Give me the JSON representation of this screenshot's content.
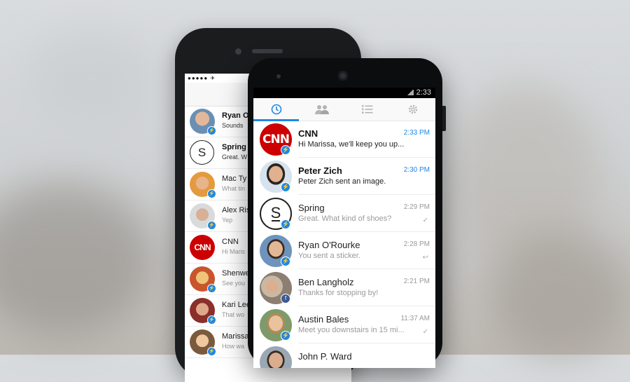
{
  "colors": {
    "accent": "#1e88e5",
    "messenger_badge": "#1e88e5",
    "facebook_badge": "#3b5998",
    "cnn_red": "#cc0000"
  },
  "iphone": {
    "status": "●●●●● ✈",
    "rows": [
      {
        "name": "Ryan O",
        "preview": "Sounds",
        "bold": true,
        "badge": "messenger-icon"
      },
      {
        "name": "Spring",
        "preview": "Great. W",
        "bold": true,
        "badge": "none"
      },
      {
        "name": "Mac Ty",
        "preview": "What tin",
        "bold": false,
        "badge": "messenger-icon"
      },
      {
        "name": "Alex Ris",
        "preview": "Yep",
        "bold": false,
        "badge": "messenger-icon"
      },
      {
        "name": "CNN",
        "preview": "Hi Maris",
        "bold": false,
        "badge": "none"
      },
      {
        "name": "Shenwe",
        "preview": "See you",
        "bold": false,
        "badge": "messenger-icon"
      },
      {
        "name": "Kari Lee",
        "preview": "That wo",
        "bold": false,
        "badge": "messenger-icon"
      },
      {
        "name": "Marissa",
        "preview": "How wa",
        "bold": false,
        "badge": "messenger-icon"
      }
    ]
  },
  "android": {
    "status_time": "2:33",
    "tabs": [
      {
        "icon": "clock-icon",
        "active": true
      },
      {
        "icon": "people-icon",
        "active": false
      },
      {
        "icon": "list-icon",
        "active": false
      },
      {
        "icon": "gear-icon",
        "active": false
      }
    ],
    "conversations": [
      {
        "name": "CNN",
        "preview": "Hi Marissa, we'll keep you up...",
        "time": "2:33 PM",
        "unread": true,
        "status": "",
        "avatar": "cnn-logo",
        "badge": "messenger-icon"
      },
      {
        "name": "Peter Zich",
        "preview": "Peter Zich sent an image.",
        "time": "2:30 PM",
        "unread": true,
        "status": "",
        "avatar": "photo",
        "badge": "messenger-icon"
      },
      {
        "name": "Spring",
        "preview": "Great. What kind of shoes?",
        "time": "2:29 PM",
        "unread": false,
        "status": "✓",
        "avatar": "spring-logo",
        "badge": "messenger-icon"
      },
      {
        "name": "Ryan O'Rourke",
        "preview": "You sent a sticker.",
        "time": "2:28 PM",
        "unread": false,
        "status": "↩",
        "avatar": "photo",
        "badge": "messenger-icon"
      },
      {
        "name": "Ben Langholz",
        "preview": "Thanks for stopping by!",
        "time": "2:21 PM",
        "unread": false,
        "status": "",
        "avatar": "photo",
        "badge": "facebook-icon"
      },
      {
        "name": "Austin Bales",
        "preview": "Meet you downstairs in 15 mi...",
        "time": "11:37 AM",
        "unread": false,
        "status": "✓",
        "avatar": "photo",
        "badge": "messenger-icon"
      },
      {
        "name": "John P. Ward",
        "preview": "",
        "time": "",
        "unread": false,
        "status": "",
        "avatar": "photo",
        "badge": "messenger-icon"
      }
    ]
  }
}
